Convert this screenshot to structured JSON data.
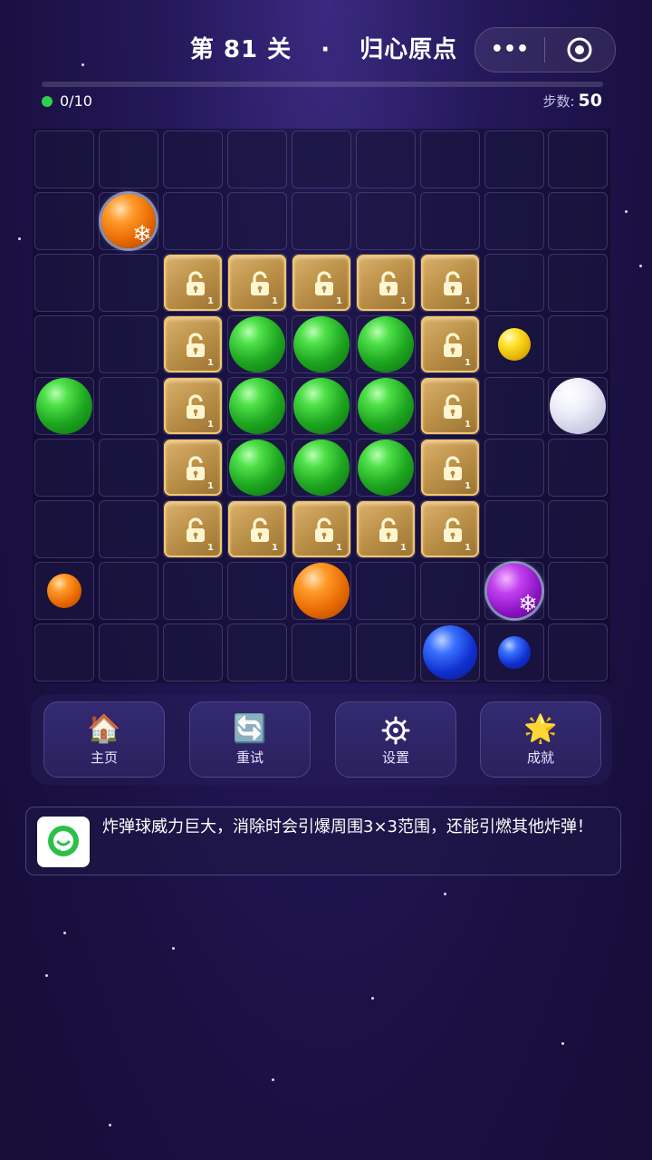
{
  "header": {
    "level": "第 81 关",
    "separator": "·",
    "level_name": "归心原点",
    "menu_dots": "•••"
  },
  "progress": {
    "collected": "0/10",
    "fraction": 0.0,
    "steps_label": "步数:",
    "steps_value": "50"
  },
  "board": {
    "cols": 9,
    "rows": 9,
    "lock_count": "1"
  },
  "toolbar": {
    "home_label": "主页",
    "home_icon": "house-icon",
    "retry_label": "重试",
    "retry_icon": "retry-arrows-icon",
    "settings_label": "设置",
    "settings_icon": "gear-icon",
    "achievements_label": "成就",
    "achievements_icon": "star-icon"
  },
  "tip": {
    "text": "炸弹球威力巨大，消除时会引爆周围3×3范围，还能引燃其他炸弹！"
  },
  "colors": {
    "green": "#1ea820",
    "lock_border": "#f2c76a",
    "accent": "#35c94a"
  }
}
